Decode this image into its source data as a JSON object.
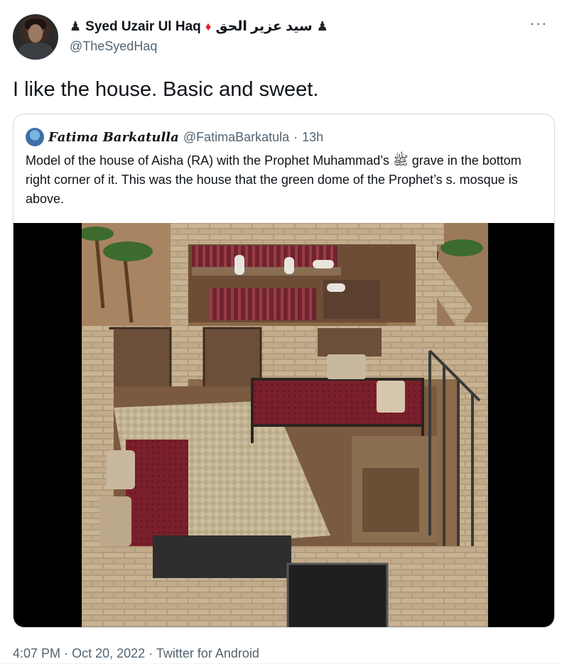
{
  "author": {
    "display_name_prefix": "♟",
    "display_name": "Syed Uzair Ul Haq",
    "display_name_arabic": "سید عزیر الحق",
    "display_name_suffix": "♟",
    "diamond": "♦",
    "handle": "@TheSyedHaq",
    "avatar_icon": "profile-photo"
  },
  "more_label": "···",
  "tweet_text": "I like the house. Basic and sweet.",
  "quoted": {
    "display_name": "𝑭𝒂𝒕𝒊𝒎𝒂 𝑩𝒂𝒓𝒌𝒂𝒕𝒖𝒍𝒍𝒂",
    "handle": "@FatimaBarkatula",
    "separator": "·",
    "time": "13h",
    "text": "Model of the house of Aisha (RA) with the Prophet Muhammad’s ﷺ grave in the bottom right corner of it. This was the house that the green dome of the Prophet’s s. mosque is above.",
    "media_description": "photo"
  },
  "footer": {
    "time": "4:07 PM",
    "sep1": "·",
    "date": "Oct 20, 2022",
    "sep2": "·",
    "source": "Twitter for Android"
  },
  "colors": {
    "text": "#0f1419",
    "secondary": "#536471",
    "border": "#cfd9de",
    "diamond": "#e0202a"
  }
}
